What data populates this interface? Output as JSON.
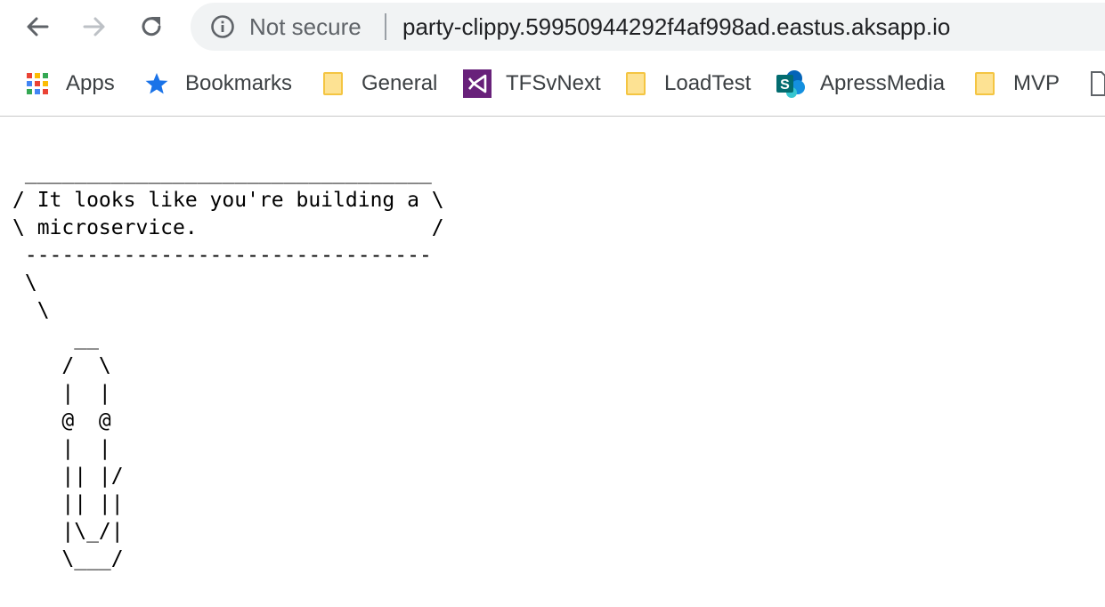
{
  "browser": {
    "security_label": "Not secure",
    "url": "party-clippy.59950944292f4af998ad.eastus.aksapp.io",
    "nav_icons": [
      "back-arrow-icon",
      "forward-arrow-icon",
      "reload-icon",
      "info-icon"
    ]
  },
  "bookmarks": {
    "items": [
      {
        "label": "Apps",
        "icon": "apps-grid-icon"
      },
      {
        "label": "Bookmarks",
        "icon": "star-icon"
      },
      {
        "label": "General",
        "icon": "folder-icon"
      },
      {
        "label": "TFSvNext",
        "icon": "visual-studio-icon"
      },
      {
        "label": "LoadTest",
        "icon": "folder-icon"
      },
      {
        "label": "ApressMedia",
        "icon": "sharepoint-icon"
      },
      {
        "label": "MVP",
        "icon": "folder-icon"
      }
    ]
  },
  "page": {
    "ascii_art": " _________________________________\n/ It looks like you're building a \\\n\\ microservice.                   /\n ---------------------------------\n \\\n  \\\n     __\n    /  \\\n    |  |\n    @  @\n    |  |\n    || |/\n    || ||\n    |\\_/|\n    \\___/"
  },
  "colors": {
    "omnibox_bg": "#f1f3f4",
    "star": "#1a73e8",
    "visual_studio": "#68217a",
    "sharepoint": "#0364b8",
    "folder": "#fde293"
  }
}
